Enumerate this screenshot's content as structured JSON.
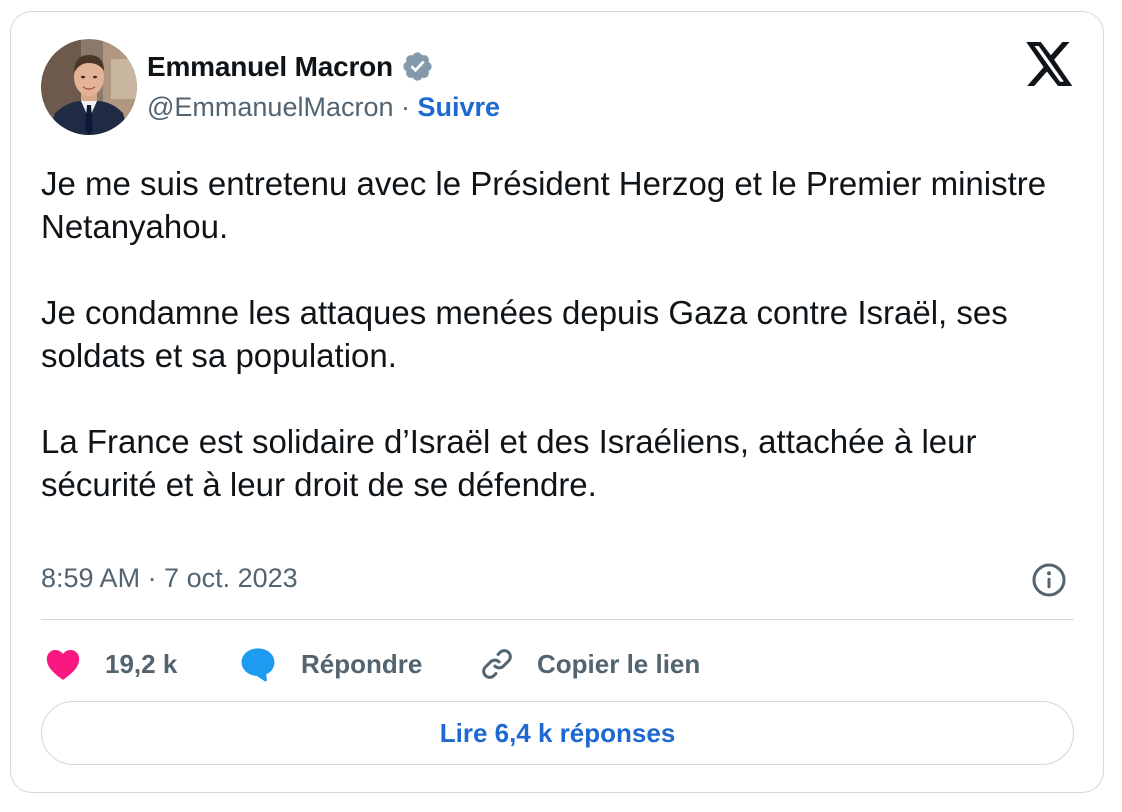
{
  "author": {
    "name": "Emmanuel Macron",
    "handle": "@EmmanuelMacron",
    "separator": " · ",
    "follow_label": "Suivre",
    "verified": true
  },
  "tweet": {
    "paragraphs": [
      "Je me suis entretenu avec le Président Herzog et le Premier ministre Netanyahou.",
      "Je condamne les attaques menées depuis Gaza contre Israël, ses soldats et sa population.",
      "La France est solidaire d’Israël et des Israéliens, attachée à leur sécurité et à leur droit de se défendre."
    ],
    "timestamp": "8:59 AM · 7 oct. 2023"
  },
  "actions": {
    "like_count": "19,2 k",
    "reply_label": "Répondre",
    "copy_link_label": "Copier le lien"
  },
  "read_replies_label": "Lire 6,4 k réponses",
  "icons": {
    "logo": "x-logo-icon",
    "verified": "verified-badge-icon",
    "info": "info-icon",
    "like": "heart-icon",
    "reply": "speech-bubble-icon",
    "copy": "link-icon"
  },
  "colors": {
    "text": "#0f1419",
    "muted": "#536471",
    "link": "#1d68d1",
    "like": "#f91880",
    "reply": "#1d9bf0",
    "verified_badge": "#829aab",
    "border": "#cfd9de"
  }
}
